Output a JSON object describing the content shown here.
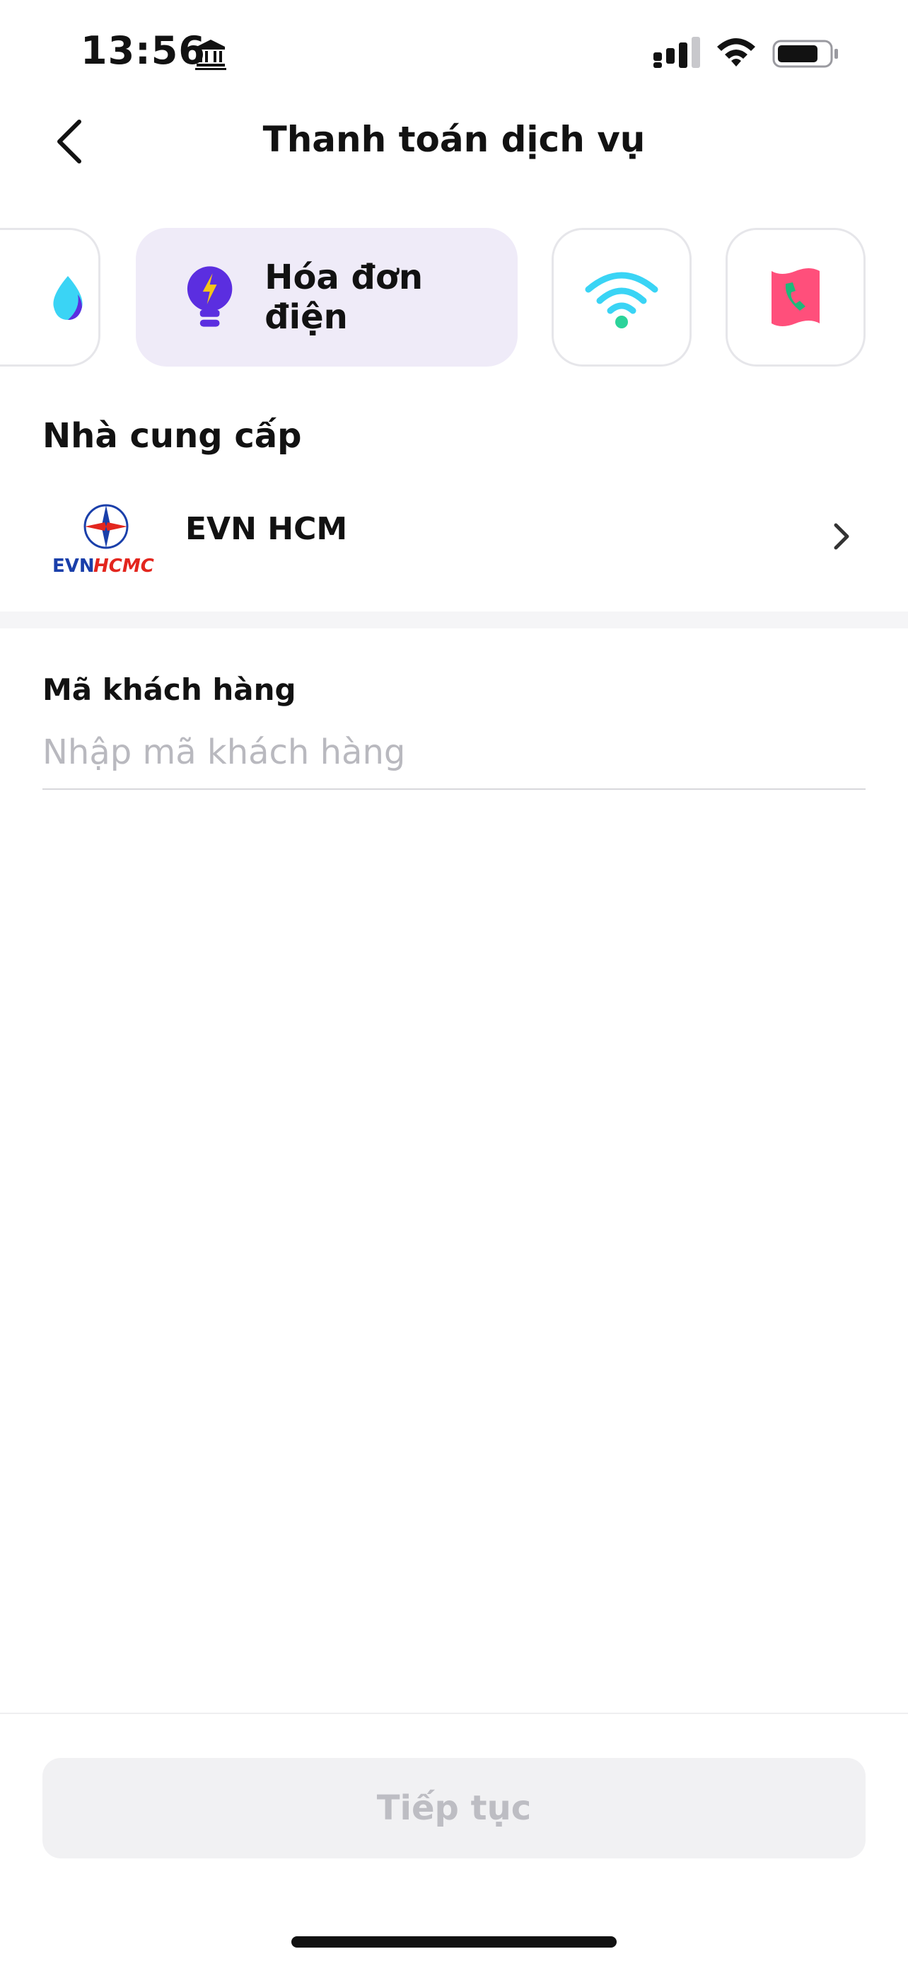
{
  "status_bar": {
    "time": "13:56",
    "icons": [
      "bank-icon",
      "signal-icon",
      "wifi-icon",
      "battery-icon"
    ]
  },
  "header": {
    "title": "Thanh toán dịch vụ",
    "back_icon": "chevron-left-icon"
  },
  "categories": [
    {
      "icon": "water-drop-icon",
      "label": "",
      "active": false
    },
    {
      "icon": "lightbulb-icon",
      "label": "Hóa đơn điện",
      "active": true
    },
    {
      "icon": "wifi-icon",
      "label": "",
      "active": false
    },
    {
      "icon": "phone-ticket-icon",
      "label": "",
      "active": false
    }
  ],
  "provider_section": {
    "label": "Nhà cung cấp",
    "provider_name": "EVN HCM",
    "logo_text_evn": "EVN",
    "logo_text_hcmc": "HCMC"
  },
  "customer_code": {
    "label": "Mã khách hàng",
    "placeholder": "Nhập mã khách hàng",
    "value": ""
  },
  "footer": {
    "continue_label": "Tiếp tục",
    "enabled": false
  },
  "colors": {
    "active_chip_bg": "#efebf8",
    "bulb_purple": "#5b2ee0",
    "bolt_yellow": "#f5c518",
    "wifi_cyan": "#3ad4f5",
    "wifi_dot_green": "#2bd39a",
    "phone_pink": "#ff4f7b",
    "phone_green": "#1fb87a",
    "evn_blue": "#1a3faa",
    "evn_red": "#e3261e"
  }
}
